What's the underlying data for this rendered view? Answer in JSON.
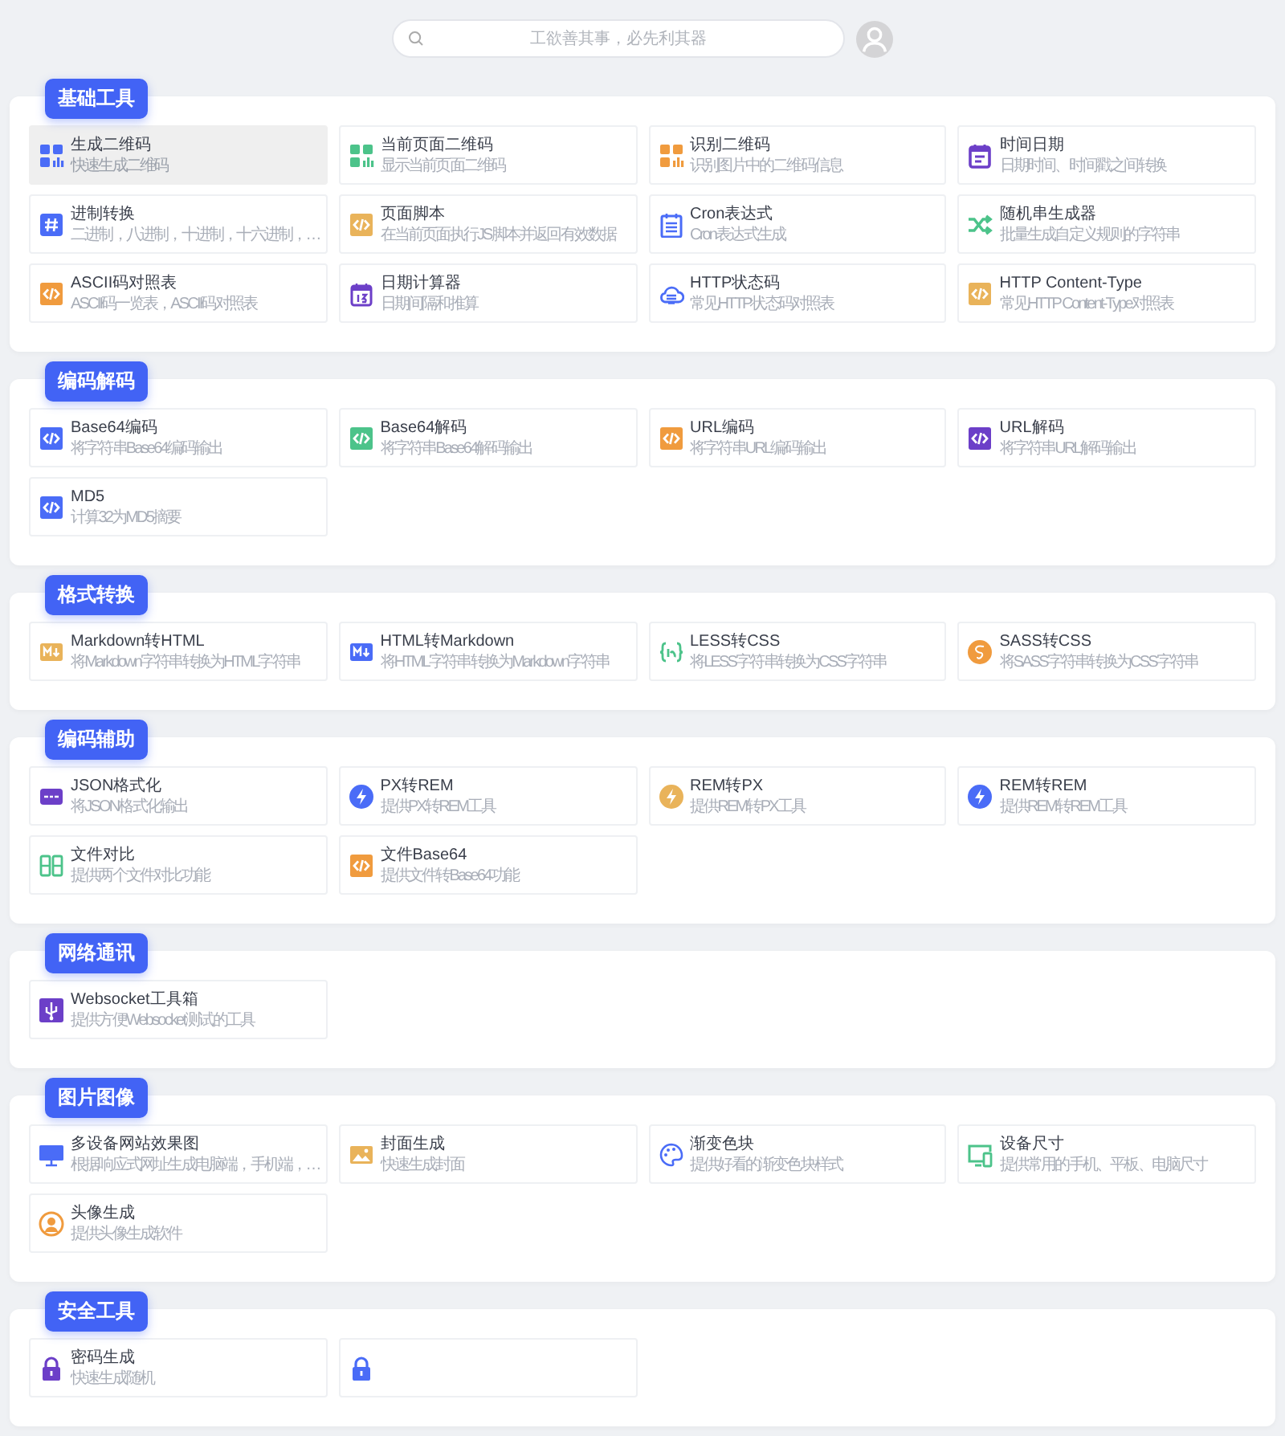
{
  "search": {
    "placeholder": "工欲善其事，必先利其器"
  },
  "sections": [
    {
      "title": "基础工具",
      "tools": [
        {
          "kind": "qr",
          "color": "#4a6cf7",
          "title": "生成二维码",
          "description": "快速生成二维码",
          "selected": true
        },
        {
          "kind": "qr",
          "color": "#4cc38a",
          "title": "当前页面二维码",
          "description": "显示当前页面二维码",
          "selected": false
        },
        {
          "kind": "qr",
          "color": "#f09b3e",
          "title": "识别二维码",
          "description": "识别图片中的二维码信息",
          "selected": false
        },
        {
          "kind": "calendar",
          "color": "#6c3fc8",
          "title": "时间日期",
          "description": "日期时间、时间戳之间转换",
          "selected": false
        },
        {
          "kind": "hash",
          "color": "#4a6cf7",
          "title": "进制转换",
          "description": "二进制，八进制，十进制，十六进制，…",
          "selected": false
        },
        {
          "kind": "code",
          "color": "#e9b35a",
          "title": "页面脚本",
          "description": "在当前页面执行JS脚本并返回有效数据",
          "selected": false
        },
        {
          "kind": "cron",
          "color": "#4a6cf7",
          "title": "Cron表达式",
          "description": "Cron表达式生成",
          "selected": false
        },
        {
          "kind": "shuffle",
          "color": "#4cc38a",
          "title": "随机串生成器",
          "description": "批量生成自定义规则的字符串",
          "selected": false
        },
        {
          "kind": "code",
          "color": "#f09b3e",
          "title": "ASCII码对照表",
          "description": "ASCII码一览表，ASCII码对照表",
          "selected": false
        },
        {
          "kind": "datecalc",
          "color": "#6c3fc8",
          "title": "日期计算器",
          "description": "日期间隔和推算",
          "selected": false
        },
        {
          "kind": "cloud",
          "color": "#4a6cf7",
          "title": "HTTP状态码",
          "description": "常见HTTP状态码对照表",
          "selected": false
        },
        {
          "kind": "code",
          "color": "#e9b35a",
          "title": "HTTP Content-Type",
          "description": "常见HTTP Content-Type对照表",
          "selected": false
        }
      ]
    },
    {
      "title": "编码解码",
      "tools": [
        {
          "kind": "code",
          "color": "#4a6cf7",
          "title": "Base64编码",
          "description": "将字符串Base64编码输出",
          "selected": false
        },
        {
          "kind": "code",
          "color": "#4cc38a",
          "title": "Base64解码",
          "description": "将字符串Base64解码输出",
          "selected": false
        },
        {
          "kind": "code",
          "color": "#f09b3e",
          "title": "URL编码",
          "description": "将字符串URL编码输出",
          "selected": false
        },
        {
          "kind": "code",
          "color": "#6c3fc8",
          "title": "URL解码",
          "description": "将字符串URL解码输出",
          "selected": false
        },
        {
          "kind": "code",
          "color": "#4a6cf7",
          "title": "MD5",
          "description": "计算32为MD5摘要",
          "selected": false
        }
      ]
    },
    {
      "title": "格式转换",
      "tools": [
        {
          "kind": "markdown",
          "color": "#e9b35a",
          "title": "Markdown转HTML",
          "description": "将Markdown字符串转换为HTML字符串",
          "selected": false
        },
        {
          "kind": "markdown",
          "color": "#4a6cf7",
          "title": "HTML转Markdown",
          "description": "将HTML字符串转换为Markdown字符串",
          "selected": false
        },
        {
          "kind": "braces",
          "color": "#4cc38a",
          "title": "LESS转CSS",
          "description": "将LESS字符串转换为CSS字符串",
          "selected": false
        },
        {
          "kind": "swirl",
          "color": "#f09b3e",
          "title": "SASS转CSS",
          "description": "将SASS字符串转换为CSS字符串",
          "selected": false
        }
      ]
    },
    {
      "title": "编码辅助",
      "tools": [
        {
          "kind": "json",
          "color": "#6c3fc8",
          "title": "JSON格式化",
          "description": "将JSON格式化输出",
          "selected": false
        },
        {
          "kind": "bolt",
          "color": "#4a6cf7",
          "title": "PX转REM",
          "description": "提供PX转REM工具",
          "selected": false
        },
        {
          "kind": "bolt",
          "color": "#e9b35a",
          "title": "REM转PX",
          "description": "提供REM转PX工具",
          "selected": false
        },
        {
          "kind": "bolt",
          "color": "#4a6cf7",
          "title": "REM转REM",
          "description": "提供REM转REM工具",
          "selected": false
        },
        {
          "kind": "split",
          "color": "#4cc38a",
          "title": "文件对比",
          "description": "提供两个文件对比功能",
          "selected": false
        },
        {
          "kind": "code",
          "color": "#f09b3e",
          "title": "文件Base64",
          "description": "提供文件转Base64功能",
          "selected": false
        }
      ]
    },
    {
      "title": "网络通讯",
      "tools": [
        {
          "kind": "usb",
          "color": "#6c3fc8",
          "title": "Websocket工具箱",
          "description": "提供方便Websocket测试的工具",
          "selected": false
        }
      ]
    },
    {
      "title": "图片图像",
      "tools": [
        {
          "kind": "monitor",
          "color": "#4a6cf7",
          "title": "多设备网站效果图",
          "description": "根据响应式网址生成电脑端，手机端，…",
          "selected": false
        },
        {
          "kind": "image",
          "color": "#e9b35a",
          "title": "封面生成",
          "description": "快速生成封面",
          "selected": false
        },
        {
          "kind": "palette",
          "color": "#4a6cf7",
          "title": "渐变色块",
          "description": "提供好看的渐变色块样式",
          "selected": false
        },
        {
          "kind": "devices",
          "color": "#4cc38a",
          "title": "设备尺寸",
          "description": "提供常用的手机、平板、电脑尺寸",
          "selected": false
        },
        {
          "kind": "avatar",
          "color": "#f09b3e",
          "title": "头像生成",
          "description": "提供头像生成软件",
          "selected": false
        }
      ]
    },
    {
      "title": "安全工具",
      "tools": [
        {
          "kind": "lock",
          "color": "#6c3fc8",
          "title": "密码生成",
          "description": "快速生成随机",
          "selected": false
        },
        {
          "kind": "lock",
          "color": "#4a6cf7",
          "selected": false
        }
      ]
    }
  ]
}
